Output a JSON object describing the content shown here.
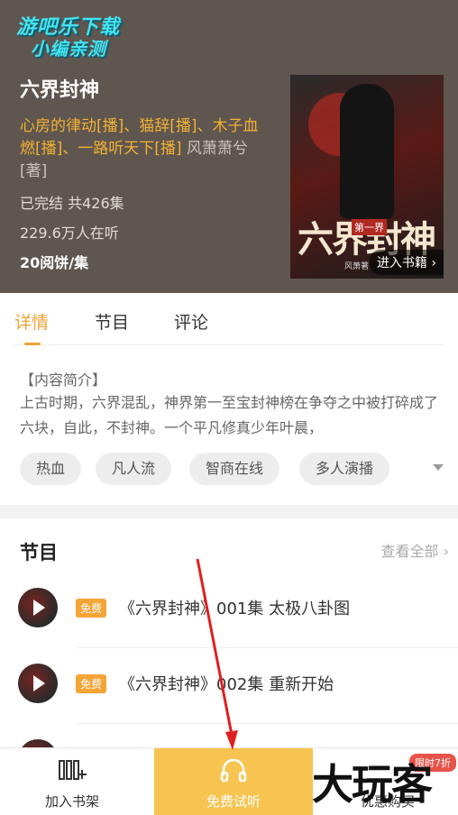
{
  "watermark": {
    "line1": "游吧乐下载",
    "line2": "小编亲测"
  },
  "book": {
    "title": "六界封神",
    "authors_highlight": "心房的律动[播]、猫辞[播]、木子血燃[播]、一路听天下[播]",
    "authors_plain": " 风萧萧兮[著]",
    "status": "已完结 共426集",
    "listeners": "229.6万人在听",
    "price": "20阅饼/集",
    "cover": {
      "title": "六界封神",
      "subtitle": "第一界",
      "author": "风萧著",
      "enter_label": "进入书籍"
    }
  },
  "tabs": [
    {
      "label": "详情",
      "active": true
    },
    {
      "label": "节目",
      "active": false
    },
    {
      "label": "评论",
      "active": false
    }
  ],
  "intro": {
    "label": "【内容简介】",
    "text": "上古时期，六界混乱，神界第一至宝封神榜在争夺之中被打碎成了六块，自此，不封神。一个平凡修真少年叶晨，"
  },
  "tags": [
    "热血",
    "凡人流",
    "智商在线",
    "多人演播"
  ],
  "episodes_section": {
    "title": "节目",
    "view_all": "查看全部",
    "items": [
      {
        "badge": "免费",
        "title": "《六界封神》001集 太极八卦图"
      },
      {
        "badge": "免费",
        "title": "《六界封神》002集 重新开始"
      }
    ]
  },
  "bottom_bar": {
    "add_shelf": "加入书架",
    "free_listen": "免费试听",
    "discount_buy": "优惠购买",
    "limited_badge": "限时7折"
  },
  "brand_watermark": "大玩客",
  "colors": {
    "accent": "#f0a235",
    "header_bg": "#605650",
    "free_listen_bg": "#f7c451",
    "annotation_arrow": "#e02020"
  }
}
